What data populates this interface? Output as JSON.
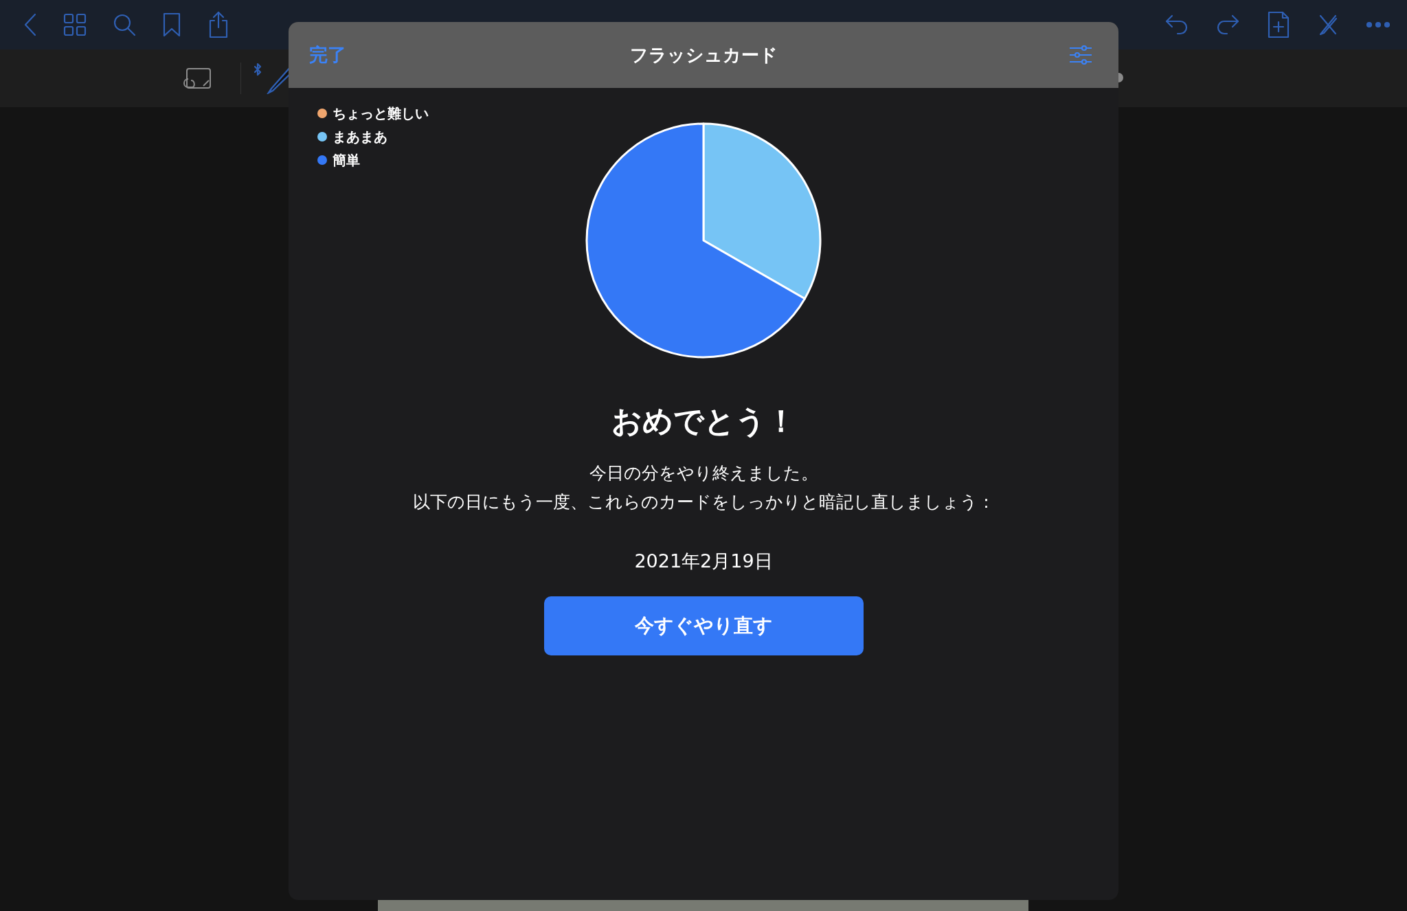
{
  "modal": {
    "done": "完了",
    "title": "フラッシュカード",
    "chart_data": {
      "type": "pie",
      "categories": [
        "ちょっと難しい",
        "まあまあ",
        "簡単"
      ],
      "values": [
        0,
        33.3,
        66.7
      ],
      "colors": [
        "#f0a66e",
        "#76c4f5",
        "#3478f6"
      ]
    },
    "heading": "おめでとう！",
    "message_lines": [
      "今日の分をやり終えました。",
      "以下の日にもう一度、これらのカードをしっかりと暗記し直しましょう："
    ],
    "date": "2021年2月19日",
    "button": "今すぐやり直す"
  }
}
